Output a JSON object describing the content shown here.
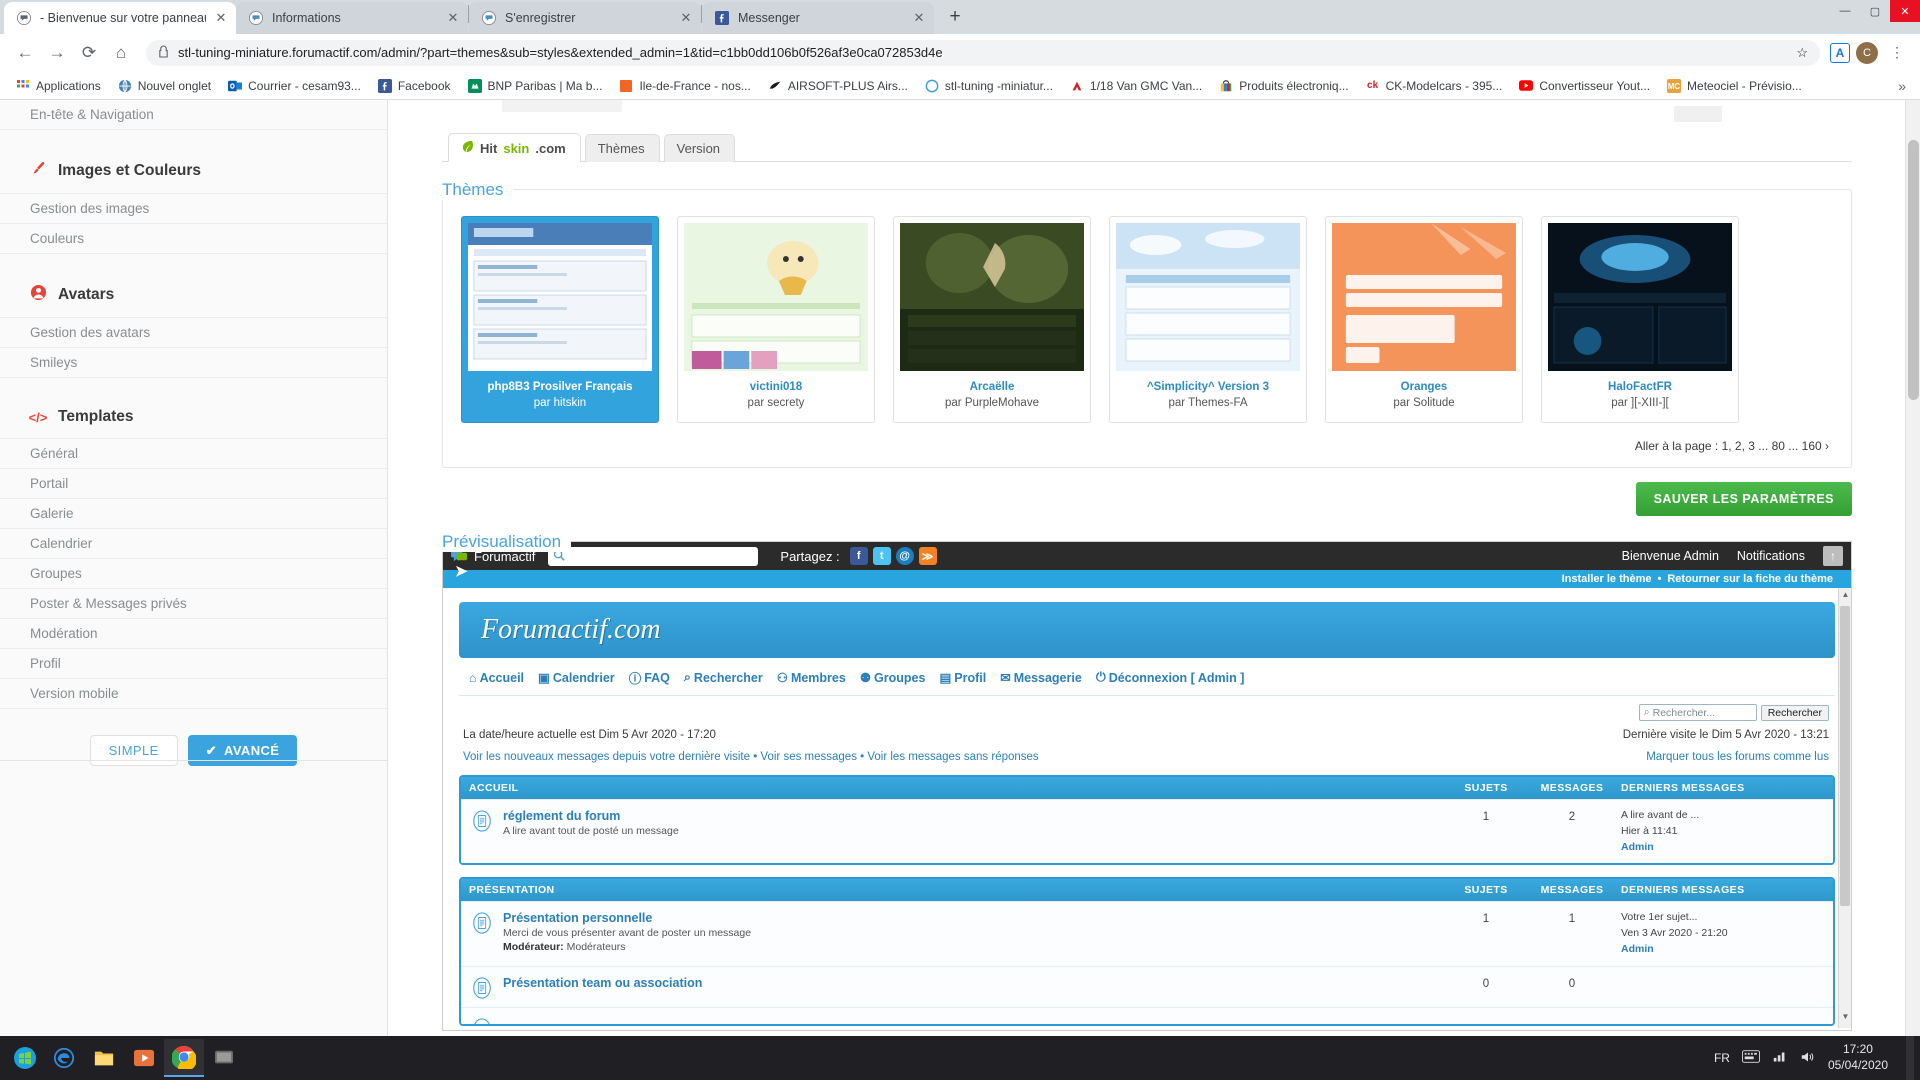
{
  "browser": {
    "tabs": [
      {
        "title": "- Bienvenue sur votre panneau d",
        "favicon": "forum-icon",
        "active": true,
        "close": "✕"
      },
      {
        "title": "Informations",
        "favicon": "forum-icon",
        "active": false,
        "close": "✕"
      },
      {
        "title": "S'enregistrer",
        "favicon": "forum-icon",
        "active": false,
        "close": "✕"
      },
      {
        "title": "Messenger",
        "favicon": "facebook-icon",
        "active": false,
        "close": "✕"
      }
    ],
    "new_tab_label": "+",
    "window_controls": {
      "minimize": "—",
      "maximize": "▢",
      "close": "✕"
    },
    "nav": {
      "back": "←",
      "forward": "→",
      "reload": "⟳",
      "home": "⌂"
    },
    "omnibox": {
      "lock_icon": "lock-icon",
      "url": "stl-tuning-miniature.forumactif.com/admin/?part=themes&sub=styles&extended_admin=1&tid=c1bb0dd106b0f526af3e0ca072853d4e",
      "star_icon": "star-icon"
    },
    "profile_initial": "C",
    "translate_badge": "A",
    "menu_icon": "⋮",
    "bookmarks": [
      {
        "label": "Applications",
        "icon": "apps-grid-icon"
      },
      {
        "label": "Nouvel onglet",
        "icon": "globe-icon"
      },
      {
        "label": "Courrier - cesam93...",
        "icon": "outlook-icon"
      },
      {
        "label": "Facebook",
        "icon": "facebook-icon"
      },
      {
        "label": "BNP Paribas | Ma b...",
        "icon": "bnp-icon"
      },
      {
        "label": "Ile-de-France - nos...",
        "icon": "orange-square-icon"
      },
      {
        "label": "AIRSOFT-PLUS Airs...",
        "icon": "airsoft-icon"
      },
      {
        "label": "stl-tuning -miniatur...",
        "icon": "forum-icon"
      },
      {
        "label": "1/18 Van GMC Van...",
        "icon": "red-icon"
      },
      {
        "label": "Produits électroniq...",
        "icon": "shopping-bag-icon"
      },
      {
        "label": "CK-Modelcars - 395...",
        "icon": "ck-icon"
      },
      {
        "label": "Convertisseur Yout...",
        "icon": "youtube-icon"
      },
      {
        "label": "Meteociel - Prévisio...",
        "icon": "meteociel-icon"
      }
    ],
    "bookmarks_overflow": "»"
  },
  "sidebar": {
    "top_link": "En-tête & Navigation",
    "groups": [
      {
        "icon": "brush-icon",
        "title": "Images et Couleurs",
        "items": [
          "Gestion des images",
          "Couleurs"
        ]
      },
      {
        "icon": "user-circle-icon",
        "title": "Avatars",
        "items": [
          "Gestion des avatars",
          "Smileys"
        ]
      },
      {
        "icon": "code-icon",
        "title": "Templates",
        "items": [
          "Général",
          "Portail",
          "Galerie",
          "Calendrier",
          "Groupes",
          "Poster & Messages privés",
          "Modération",
          "Profil",
          "Version mobile"
        ]
      }
    ],
    "mode": {
      "simple": "SIMPLE",
      "advanced": "AVANCÉ",
      "advanced_check": "✔"
    }
  },
  "main": {
    "tabs": [
      {
        "label": "Hitskin.com",
        "active": true,
        "parts": {
          "hit": "Hit",
          "skin": "skin",
          "com": ".com"
        }
      },
      {
        "label": "Thèmes",
        "active": false
      },
      {
        "label": "Version",
        "active": false
      }
    ],
    "themes_panel": {
      "legend": "Thèmes",
      "themes": [
        {
          "name": "php8B3 Prosilver Français",
          "author": "par hitskin",
          "selected": true
        },
        {
          "name": "victini018",
          "author": "par secrety",
          "selected": false
        },
        {
          "name": "Arcaëlle",
          "author": "par PurpleMohave",
          "selected": false
        },
        {
          "name": "^Simplicity^ Version 3",
          "author": "par Themes-FA",
          "selected": false
        },
        {
          "name": "Oranges",
          "author": "par Solitude",
          "selected": false
        },
        {
          "name": "HaloFactFR",
          "author": "par ][-XIII-][",
          "selected": false
        }
      ],
      "pager": "Aller à la page : 1, 2, 3 ... 80 ... 160 ›"
    },
    "save_button": "SAUVER LES PARAMÈTRES",
    "preview_legend": "Prévisualisation"
  },
  "preview": {
    "topbar": {
      "brand": "Forumactif",
      "search_placeholder": "",
      "share_label": "Partagez :",
      "socials": [
        "facebook",
        "twitter",
        "at",
        "rss"
      ],
      "welcome": "Bienvenue Admin",
      "notifications": "Notifications",
      "up_arrow": "↑"
    },
    "install_bar": {
      "install": "Installer le thème",
      "separator": "•",
      "back": "Retourner sur la fiche du thème"
    },
    "banner_title": "Forumactif.com",
    "nav_items": [
      {
        "label": "Accueil",
        "icon": "home-icon"
      },
      {
        "label": "Calendrier",
        "icon": "calendar-icon"
      },
      {
        "label": "FAQ",
        "icon": "question-icon"
      },
      {
        "label": "Rechercher",
        "icon": "search-icon"
      },
      {
        "label": "Membres",
        "icon": "member-icon"
      },
      {
        "label": "Groupes",
        "icon": "groups-icon"
      },
      {
        "label": "Profil",
        "icon": "profile-icon"
      },
      {
        "label": "Messagerie",
        "icon": "mail-icon"
      },
      {
        "label": "Déconnexion [ Admin ]",
        "icon": "power-icon"
      }
    ],
    "search": {
      "placeholder": "Rechercher...",
      "button": "Rechercher",
      "icon": "search-icon"
    },
    "current_datetime": "La date/heure actuelle est Dim 5 Avr 2020 - 17:20",
    "last_visit": "Dernière visite le Dim 5 Avr 2020 - 13:21",
    "quick_links_left": "Voir les nouveaux messages depuis votre dernière visite • Voir ses messages • Voir les messages sans réponses",
    "quick_links_right": "Marquer tous les forums comme lus",
    "columns": {
      "topics": "SUJETS",
      "posts": "MESSAGES",
      "last": "DERNIERS MESSAGES"
    },
    "categories": [
      {
        "title": "ACCUEIL",
        "forums": [
          {
            "name": "réglement du forum",
            "desc": "A lire avant tout de posté un message",
            "moderator_label": "",
            "moderator": "",
            "topics": "1",
            "posts": "2",
            "last_title": "A lire avant de ...",
            "last_date": "Hier à 11:41",
            "last_user": "Admin"
          }
        ]
      },
      {
        "title": "PRÉSENTATION",
        "forums": [
          {
            "name": "Présentation personnelle",
            "desc": "Merci de vous présenter avant de poster un message",
            "moderator_label": "Modérateur:",
            "moderator": "Modérateurs",
            "topics": "1",
            "posts": "1",
            "last_title": "Votre 1er sujet...",
            "last_date": "Ven 3 Avr 2020 - 21:20",
            "last_user": "Admin"
          },
          {
            "name": "Présentation team ou association",
            "desc": "",
            "moderator_label": "",
            "moderator": "",
            "topics": "0",
            "posts": "0",
            "last_title": "",
            "last_date": "",
            "last_user": ""
          }
        ]
      }
    ]
  },
  "taskbar": {
    "start_icon": "windows-start-icon",
    "apps": [
      {
        "icon": "edge-icon",
        "name": "edge"
      },
      {
        "icon": "explorer-icon",
        "name": "file-explorer"
      },
      {
        "icon": "media-player-icon",
        "name": "media-player"
      },
      {
        "icon": "chrome-icon",
        "name": "chrome",
        "active": true
      },
      {
        "icon": "app-icon",
        "name": "other-app"
      }
    ],
    "tray": {
      "language": "FR",
      "icons": [
        "keyboard-icon",
        "network-icon",
        "volume-icon"
      ],
      "time": "17:20",
      "date": "05/04/2020"
    }
  }
}
